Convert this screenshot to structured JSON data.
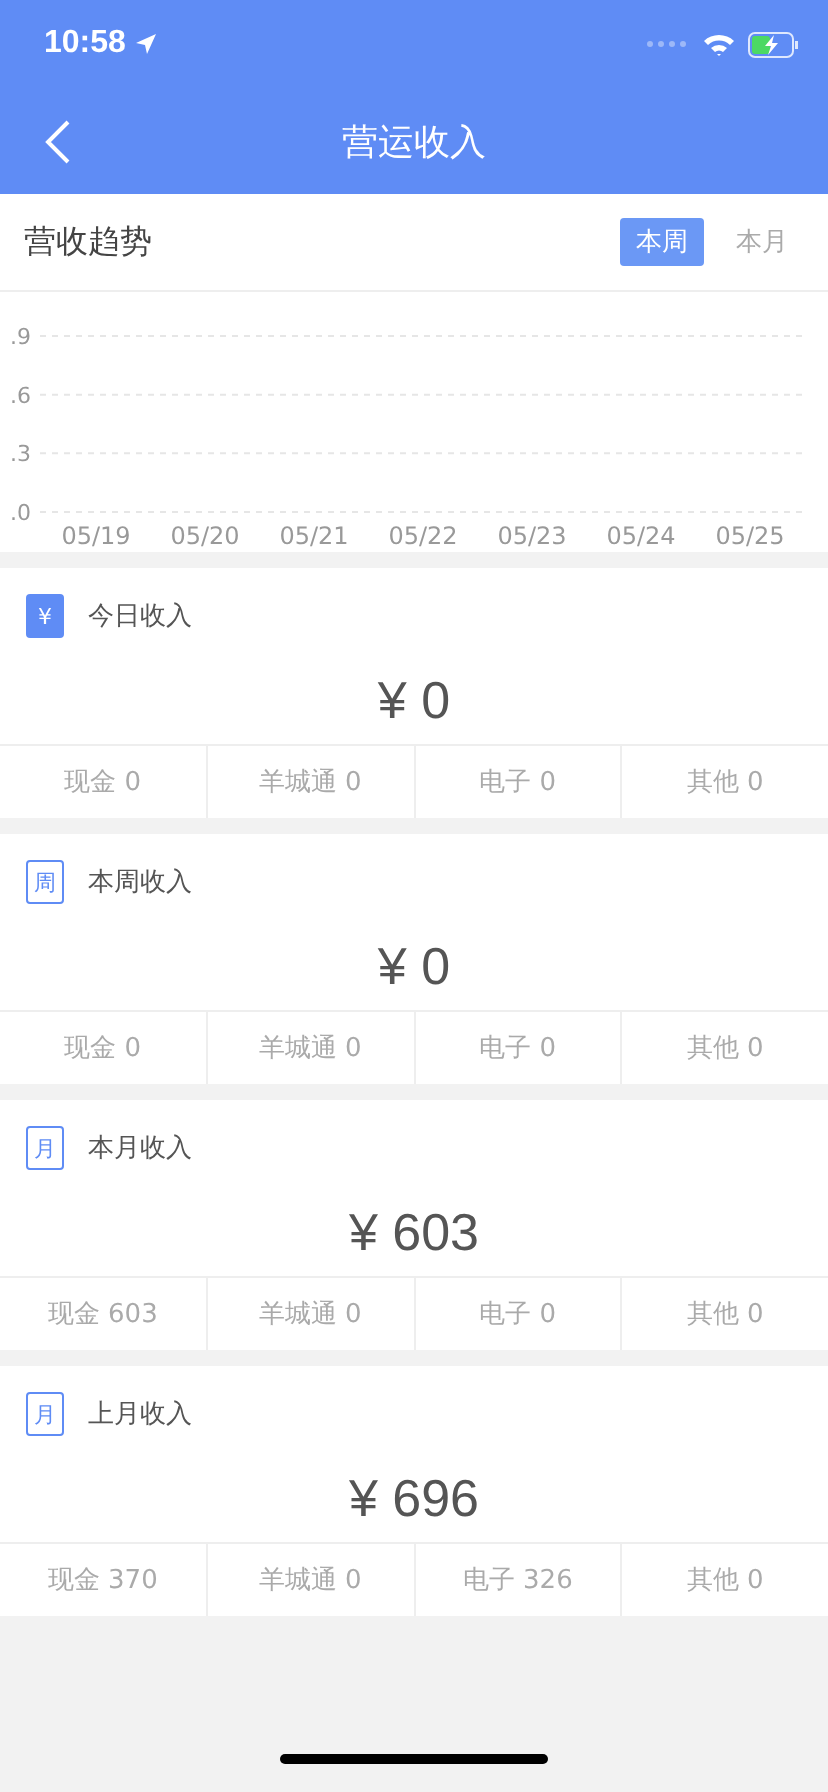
{
  "status_bar": {
    "time": "10:58"
  },
  "nav": {
    "title": "营运收入"
  },
  "trend": {
    "title": "营收趋势",
    "tabs": [
      {
        "label": "本周",
        "selected": true
      },
      {
        "label": "本月",
        "selected": false
      }
    ],
    "chart_data": {
      "type": "line",
      "categories": [
        "05/19",
        "05/20",
        "05/21",
        "05/22",
        "05/23",
        "05/24",
        "05/25"
      ],
      "ylim": [
        0,
        0.9
      ],
      "yticks": [
        {
          "value": 0,
          "label": ".0"
        },
        {
          "value": 0.3,
          "label": ".3"
        },
        {
          "value": 0.6,
          "label": ".6"
        },
        {
          "value": 0.9,
          "label": ".9"
        }
      ]
    }
  },
  "cards": [
    {
      "icon_glyph": "¥",
      "kind": "filled",
      "title": "今日收入",
      "amount": "¥ 0",
      "breakdown": [
        "现金 0",
        "羊城通 0",
        "电子 0",
        "其他 0"
      ]
    },
    {
      "icon_glyph": "周",
      "kind": "outline",
      "title": "本周收入",
      "amount": "¥ 0",
      "breakdown": [
        "现金 0",
        "羊城通 0",
        "电子 0",
        "其他 0"
      ]
    },
    {
      "icon_glyph": "月",
      "kind": "outline",
      "title": "本月收入",
      "amount": "¥ 603",
      "breakdown": [
        "现金 603",
        "羊城通 0",
        "电子 0",
        "其他 0"
      ]
    },
    {
      "icon_glyph": "月",
      "kind": "outline",
      "title": "上月收入",
      "amount": "¥ 696",
      "breakdown": [
        "现金 370",
        "羊城通 0",
        "电子 326",
        "其他 0"
      ]
    }
  ]
}
